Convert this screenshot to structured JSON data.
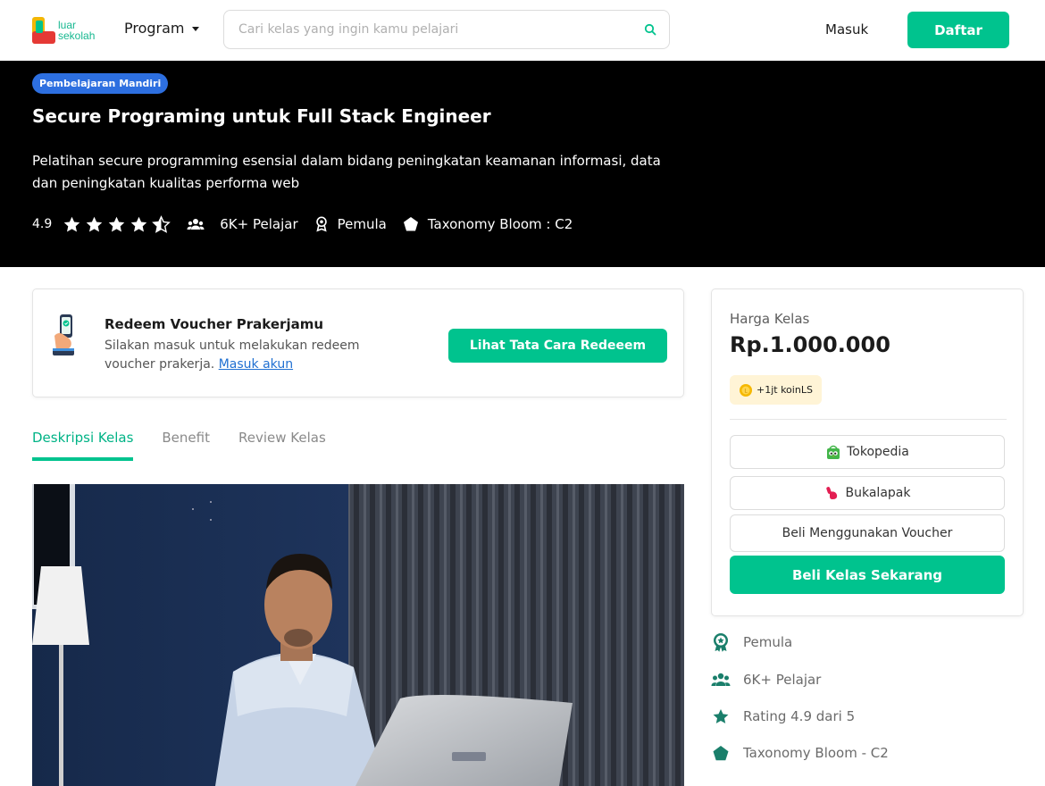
{
  "navbar": {
    "logo_line1": "luar",
    "logo_line2": "sekolah",
    "program_label": "Program",
    "search_placeholder": "Cari kelas yang ingin kamu pelajari",
    "login_label": "Masuk",
    "register_label": "Daftar"
  },
  "hero": {
    "badge": "Pembelajaran Mandiri",
    "title": "Secure Programing untuk Full Stack Engineer",
    "description": "Pelatihan secure programming esensial dalam bidang peningkatan keamanan informasi, data dan peningkatan kualitas performa web",
    "rating": "4.9",
    "stars_filled": 4.5,
    "learners": "6K+ Pelajar",
    "level": "Pemula",
    "taxonomy": "Taxonomy Bloom : C2"
  },
  "voucher": {
    "title": "Redeem Voucher Prakerjamu",
    "description": "Silakan masuk untuk melakukan redeem voucher prakerja.",
    "login_link": "Masuk akun",
    "button_label": "Lihat Tata Cara Redeeem"
  },
  "tabs": [
    {
      "label": "Deskripsi Kelas",
      "active": true
    },
    {
      "label": "Benefit",
      "active": false
    },
    {
      "label": "Review Kelas",
      "active": false
    }
  ],
  "price_card": {
    "label": "Harga Kelas",
    "price": "Rp.1.000.000",
    "koin_badge": "+1jt koinLS",
    "tokopedia_label": "Tokopedia",
    "bukalapak_label": "Bukalapak",
    "voucher_label": "Beli Menggunakan Voucher",
    "buy_label": "Beli Kelas Sekarang"
  },
  "features": [
    {
      "icon": "badge-icon",
      "label": "Pemula"
    },
    {
      "icon": "people-icon",
      "label": "6K+ Pelajar"
    },
    {
      "icon": "star-icon",
      "label": "Rating 4.9 dari 5"
    },
    {
      "icon": "pentagon-icon",
      "label": "Taxonomy Bloom - C2"
    }
  ],
  "colors": {
    "accent": "#00c38e",
    "hero_bg": "#000000",
    "badge_blue": "#2d6fe0",
    "feature_icon": "#1a7f6b"
  }
}
